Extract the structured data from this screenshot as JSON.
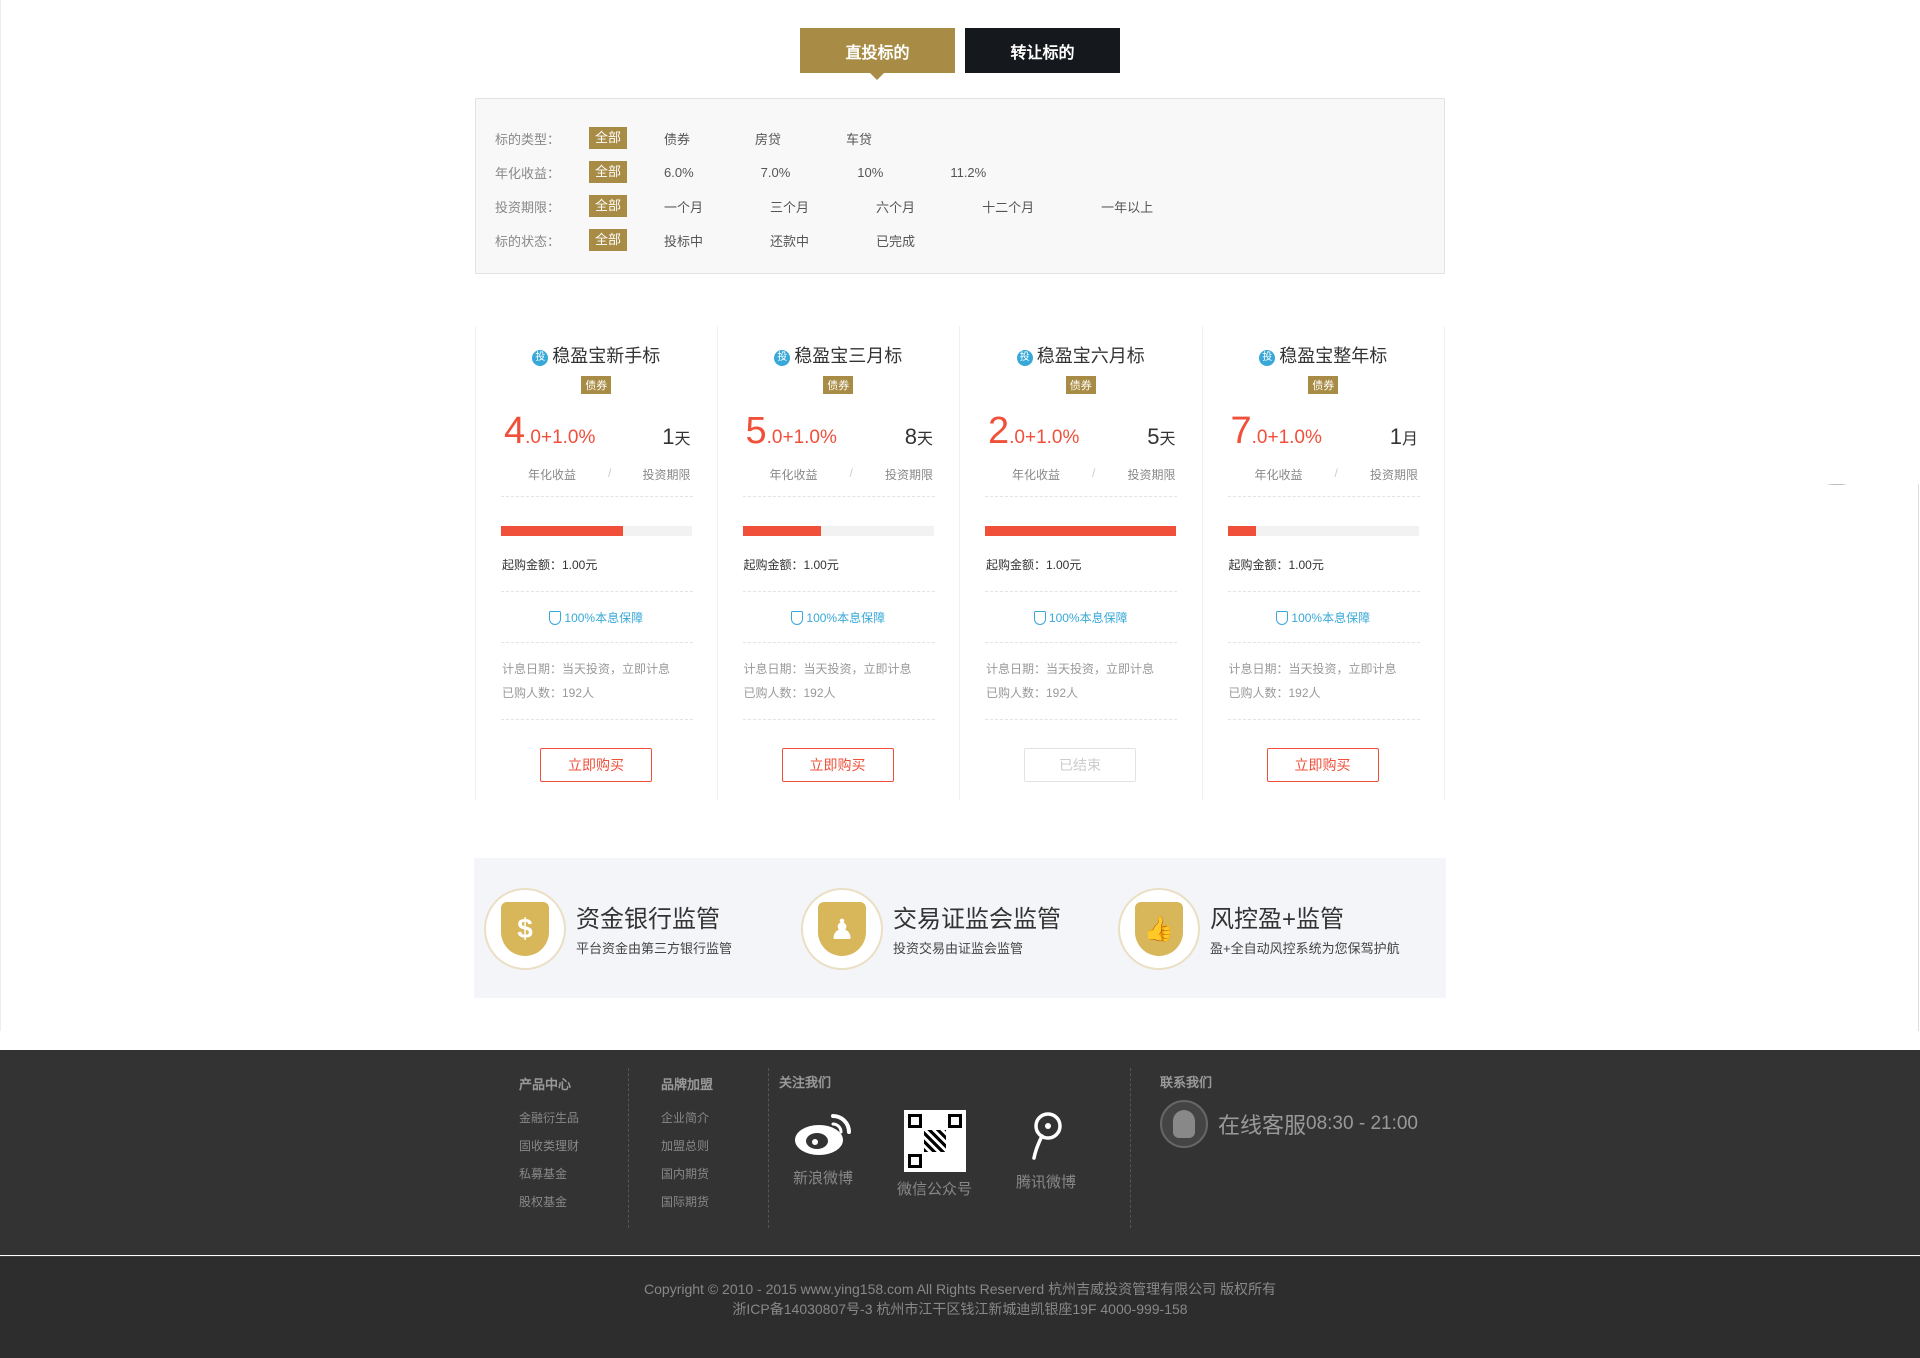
{
  "tabs": {
    "direct": "直投标的",
    "transfer": "转让标的"
  },
  "filter": {
    "rows": [
      {
        "label": "标的类型：",
        "all": "全部",
        "options": [
          "债券",
          "房贷",
          "车贷"
        ]
      },
      {
        "label": "年化收益：",
        "all": "全部",
        "options": [
          "6.0%",
          "7.0%",
          "10%",
          "11.2%"
        ]
      },
      {
        "label": "投资期限：",
        "all": "全部",
        "options": [
          "一个月",
          "三个月",
          "六个月",
          "十二个月",
          "一年以上"
        ]
      },
      {
        "label": "标的状态：",
        "all": "全部",
        "options": [
          "投标中",
          "还款中",
          "已完成"
        ]
      }
    ]
  },
  "cards": [
    {
      "icon": "投",
      "title": "稳盈宝新手标",
      "tag": "债券",
      "rate_int": "4",
      "rate_rest": ".0+1.0%",
      "term": "1",
      "term_unit": "天",
      "rate_label": "年化收益",
      "sep": "/",
      "term_label": "投资期限",
      "progress": 0.64,
      "min_amount": "起购金额：1.00元",
      "guarantee": "100%本息保障",
      "interest_date": "计息日期：当天投资，立即计息",
      "buyers": "已购人数：192人",
      "button": "立即购买",
      "ended": false
    },
    {
      "icon": "投",
      "title": "稳盈宝三月标",
      "tag": "债券",
      "rate_int": "5",
      "rate_rest": ".0+1.0%",
      "term": "8",
      "term_unit": "天",
      "rate_label": "年化收益",
      "sep": "/",
      "term_label": "投资期限",
      "progress": 0.41,
      "min_amount": "起购金额：1.00元",
      "guarantee": "100%本息保障",
      "interest_date": "计息日期：当天投资，立即计息",
      "buyers": "已购人数：192人",
      "button": "立即购买",
      "ended": false
    },
    {
      "icon": "投",
      "title": "稳盈宝六月标",
      "tag": "债券",
      "rate_int": "2",
      "rate_rest": ".0+1.0%",
      "term": "5",
      "term_unit": "天",
      "rate_label": "年化收益",
      "sep": "/",
      "term_label": "投资期限",
      "progress": 1.0,
      "min_amount": "起购金额：1.00元",
      "guarantee": "100%本息保障",
      "interest_date": "计息日期：当天投资，立即计息",
      "buyers": "已购人数：192人",
      "button": "已结束",
      "ended": true
    },
    {
      "icon": "投",
      "title": "稳盈宝整年标",
      "tag": "债券",
      "rate_int": "7",
      "rate_rest": ".0+1.0%",
      "term": "1",
      "term_unit": "月",
      "rate_label": "年化收益",
      "sep": "/",
      "term_label": "投资期限",
      "progress": 0.15,
      "min_amount": "起购金额：1.00元",
      "guarantee": "100%本息保障",
      "interest_date": "计息日期：当天投资，立即计息",
      "buyers": "已购人数：192人",
      "button": "立即购买",
      "ended": false
    }
  ],
  "features": [
    {
      "icon": "dollar-shield-icon",
      "glyph": "$",
      "title": "资金银行监管",
      "subtitle": "平台资金由第三方银行监管"
    },
    {
      "icon": "person-shield-icon",
      "glyph": "♟",
      "title": "交易证监会监管",
      "subtitle": "投资交易由证监会监管"
    },
    {
      "icon": "thumbs-up-shield-icon",
      "glyph": "👍",
      "title": "风控盈+监管",
      "subtitle": "盈+全自动风控系统为您保驾护航"
    }
  ],
  "footer": {
    "products": {
      "title": "产品中心",
      "links": [
        "金融衍生品",
        "固收类理财",
        "私募基金",
        "股权基金"
      ]
    },
    "brand": {
      "title": "品牌加盟",
      "links": [
        "企业简介",
        "加盟总则",
        "国内期货",
        "国际期货"
      ]
    },
    "follow": {
      "title": "关注我们",
      "weibo": "新浪微博",
      "wechat": "微信公众号",
      "tencent": "腾讯微博"
    },
    "contact": {
      "title": "联系我们",
      "service": "在线客服",
      "hours": "08:30 - 21:00"
    },
    "copyright": "Copyright © 2010 - 2015 www.ying158.com All Rights Reserverd 杭州吉威投资管理有限公司 版权所有",
    "icp": "浙ICP备14030807号-3 杭州市江干区钱江新城迪凯银座19F 4000-999-158"
  },
  "colors": {
    "gold": "#a88b44",
    "red": "#f04f3a",
    "blue": "#38a8d8",
    "dark": "#15181c",
    "footer": "#333333"
  }
}
